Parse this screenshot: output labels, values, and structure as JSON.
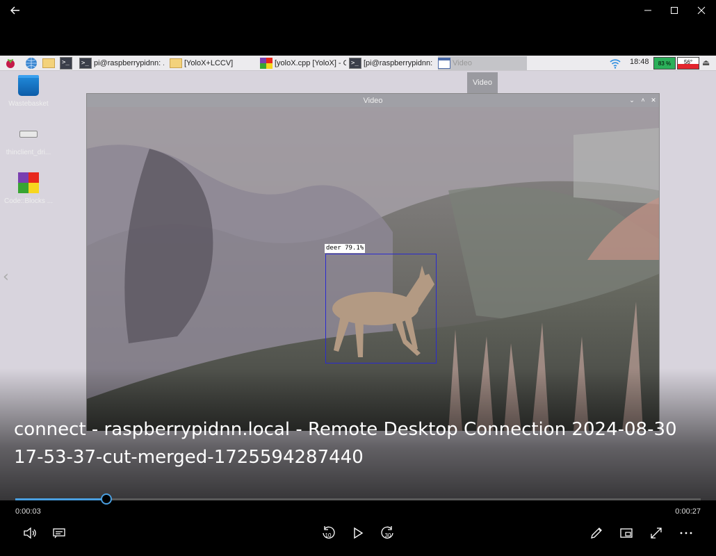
{
  "player": {
    "caption": "connect - raspberrypidnn.local - Remote Desktop Connection 2024-08-30 17-53-37-cut-merged-1725594287440",
    "current_time": "0:00:03",
    "total_time": "0:00:27",
    "progress": 0.133,
    "skip_back_seconds": "10",
    "skip_forward_seconds": "30",
    "accent": "#4a9fe0"
  },
  "taskbar": {
    "apps": [
      {
        "label": "pi@raspberrypidnn: ...",
        "icon": "terminal-icon"
      },
      {
        "label": "[YoloX+LCCV]",
        "icon": "folder-icon"
      },
      {
        "label": "[yoloX.cpp [YoloX] - C...",
        "icon": "codeblocks-icon"
      },
      {
        "label": "[pi@raspberrypidnn: ...",
        "icon": "terminal-icon"
      },
      {
        "label": "Video",
        "icon": "window-icon"
      }
    ],
    "clock": "18:48",
    "cpu": "83 %",
    "temp": "56°"
  },
  "tooltip": "Video",
  "desktop_icons": [
    {
      "label": "Wastebasket",
      "icon": "trash-icon"
    },
    {
      "label": "thinclient_dri...",
      "icon": "drive-icon"
    },
    {
      "label": "Code::Blocks ...",
      "icon": "codeblocks-icon"
    }
  ],
  "video_window": {
    "title": "Video",
    "detection_label": "deer 79.1%"
  }
}
